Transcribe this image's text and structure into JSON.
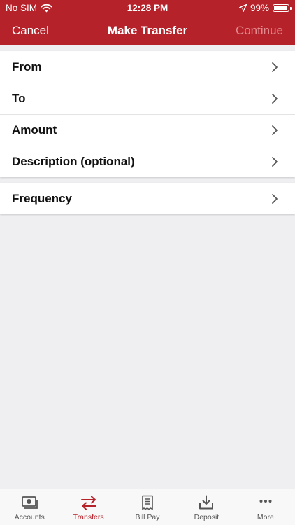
{
  "status_bar": {
    "carrier": "No SIM",
    "time": "12:28 PM",
    "battery": "99%"
  },
  "nav": {
    "left": "Cancel",
    "title": "Make Transfer",
    "right": "Continue"
  },
  "rows_group1": [
    {
      "label": "From"
    },
    {
      "label": "To"
    },
    {
      "label": "Amount"
    },
    {
      "label": "Description (optional)"
    }
  ],
  "rows_group2": [
    {
      "label": "Frequency"
    }
  ],
  "tabs": [
    {
      "label": "Accounts",
      "icon": "accounts-icon"
    },
    {
      "label": "Transfers",
      "icon": "transfers-icon",
      "active": true
    },
    {
      "label": "Bill Pay",
      "icon": "bill-pay-icon"
    },
    {
      "label": "Deposit",
      "icon": "deposit-icon"
    },
    {
      "label": "More",
      "icon": "more-icon"
    }
  ],
  "colors": {
    "brand": "#b5222a",
    "background": "#efeef0",
    "disabled_action": "#e48a8f"
  }
}
